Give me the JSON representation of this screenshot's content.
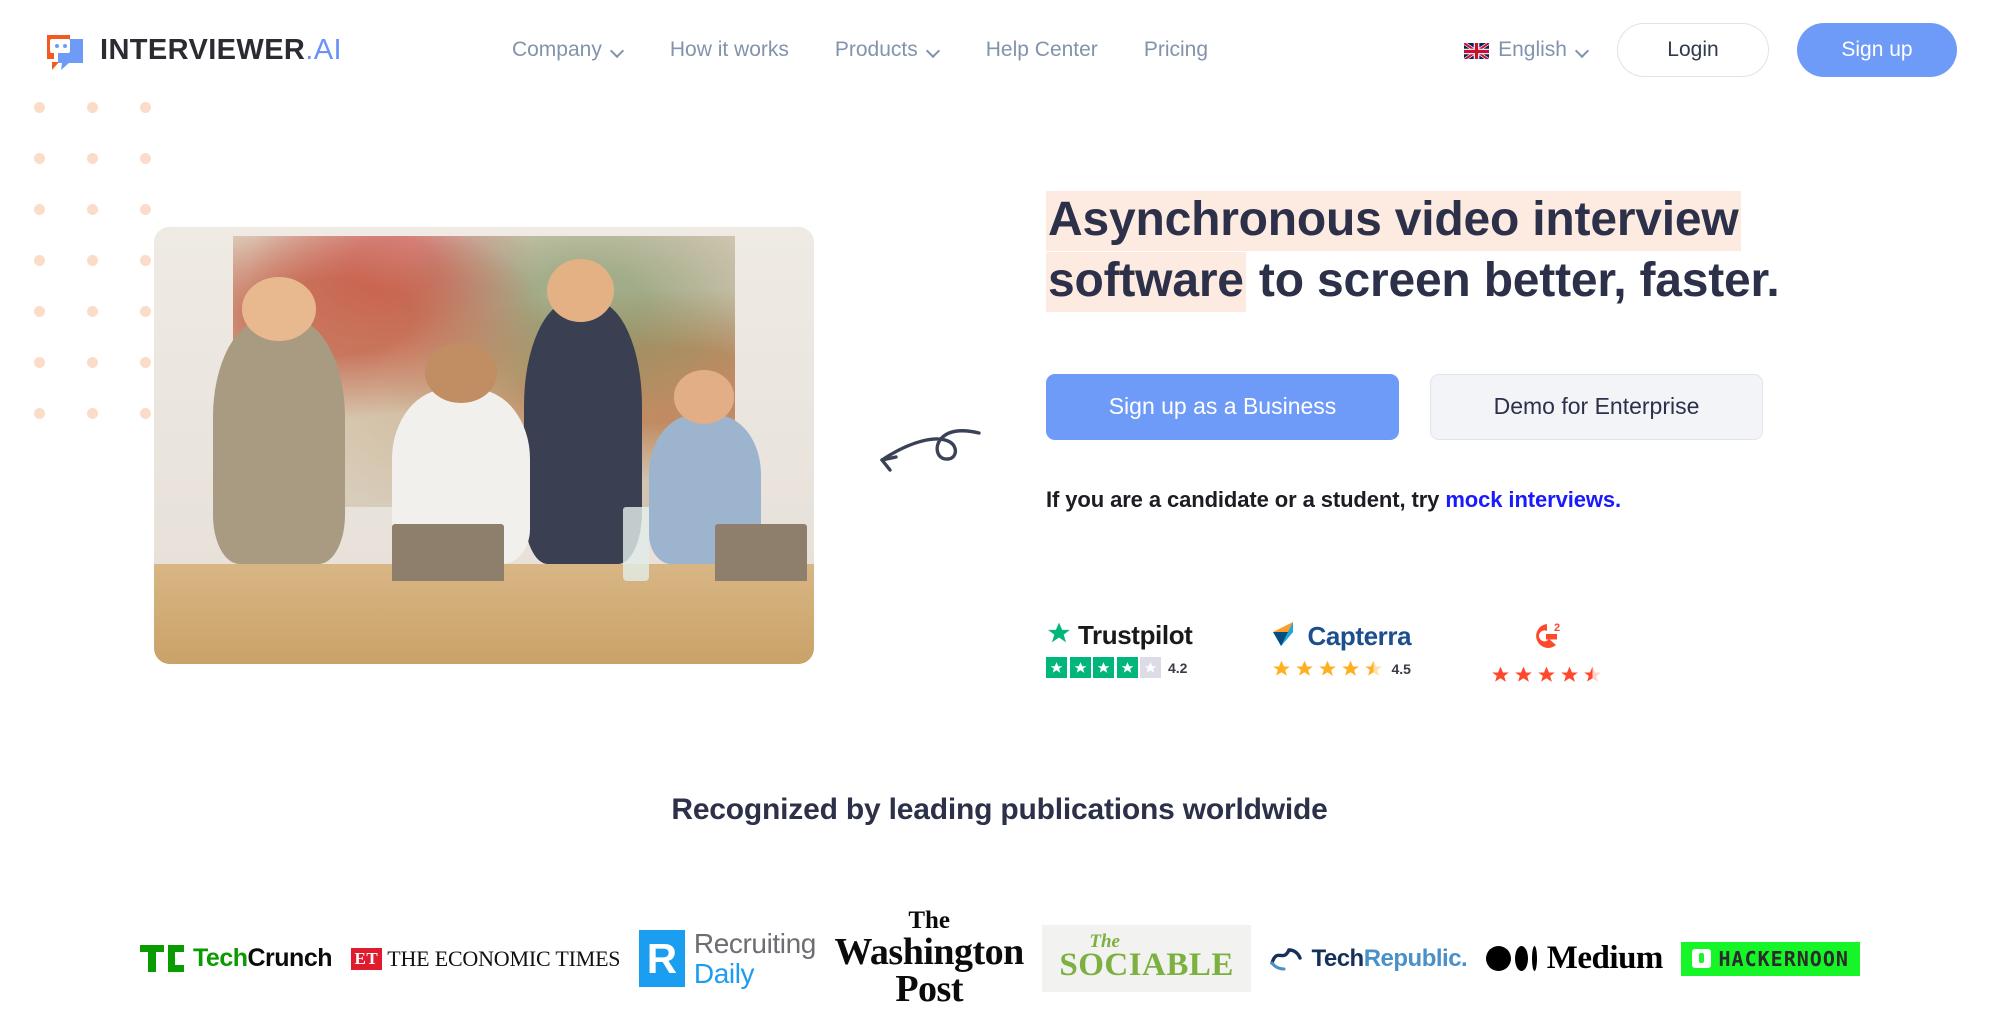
{
  "header": {
    "logo": {
      "name": "INTERVIEWER",
      "suffix": ".AI",
      "icon": "chat-bubble-logo-icon"
    },
    "nav": [
      {
        "label": "Company",
        "has_dropdown": true
      },
      {
        "label": "How it works",
        "has_dropdown": false
      },
      {
        "label": "Products",
        "has_dropdown": true
      },
      {
        "label": "Help Center",
        "has_dropdown": false
      },
      {
        "label": "Pricing",
        "has_dropdown": false
      }
    ],
    "language": {
      "label": "English",
      "flag": "uk-flag-icon",
      "has_dropdown": true
    },
    "login_label": "Login",
    "signup_label": "Sign up"
  },
  "hero": {
    "headline_highlight": "Asynchronous video interview software",
    "headline_rest": " to screen better, faster.",
    "highlight_color": "#fdeae0",
    "primary_cta": "Sign up as a Business",
    "secondary_cta": "Demo for Enterprise",
    "candidate_text": "If you are a candidate or a student, try ",
    "candidate_link": "mock interviews.",
    "link_color": "#1a1aff",
    "image_alt": "team-collaborating-at-laptop-photo",
    "arrow": "hand-drawn-curved-arrow-icon"
  },
  "badges": [
    {
      "name": "Trustpilot",
      "rating": "4.2",
      "stars_full": 4,
      "stars_empty": 1,
      "color": "#00b67a"
    },
    {
      "name": "Capterra",
      "rating": "4.5",
      "stars_full": 4,
      "stars_half": 1,
      "color": "#ff9d28"
    },
    {
      "name": "G2",
      "rating": "",
      "stars_full": 4,
      "stars_half": 1,
      "color": "#ff492c"
    }
  ],
  "publications": {
    "title": "Recognized by leading publications worldwide",
    "logos": [
      {
        "name": "TechCrunch",
        "part1": "Tech",
        "part2": "Crunch"
      },
      {
        "name": "The Economic Times",
        "badge": "ET",
        "text": "THE ECONOMIC TIMES"
      },
      {
        "name": "RecruitingDaily",
        "mark": "R",
        "line1": "Recruiting",
        "line2": "Daily"
      },
      {
        "name": "The Washington Post",
        "line1": "The",
        "line2": "Washington",
        "line3": "Post"
      },
      {
        "name": "The Sociable",
        "the": "The",
        "main": "SOCIABLE"
      },
      {
        "name": "TechRepublic",
        "part1": "Tech",
        "part2": "Republic."
      },
      {
        "name": "Medium",
        "text": "Medium"
      },
      {
        "name": "HackerNoon",
        "text": "HACKERNOON"
      }
    ]
  }
}
